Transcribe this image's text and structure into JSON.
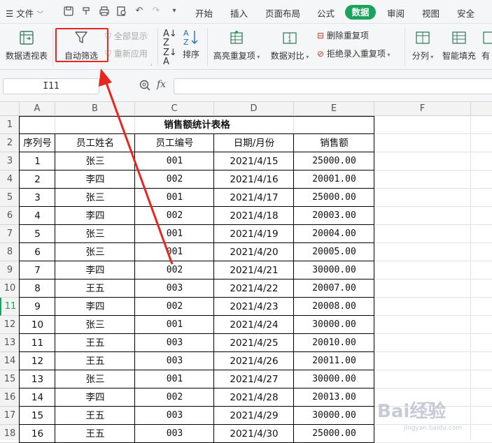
{
  "menubar": {
    "file_label": "文件",
    "tabs": [
      "开始",
      "插入",
      "页面布局",
      "公式",
      "数据",
      "审阅",
      "视图",
      "安全"
    ],
    "active_tab": "数据"
  },
  "ribbon": {
    "pivot": "数据透视表",
    "autofilter": "自动筛选",
    "show_all": "全部显示",
    "reapply": "重新应用",
    "sort": "排序",
    "highlight_dup": "高亮重复项",
    "compare": "数据对比",
    "remove_dup": "删除重复项",
    "reject_dup": "拒绝录入重复项",
    "split": "分列",
    "smart_fill": "智能填充",
    "cut_off": "有"
  },
  "formula_bar": {
    "cell_ref": "I11",
    "fx": "fx",
    "value": ""
  },
  "columns": [
    "A",
    "B",
    "C",
    "D",
    "E",
    "F"
  ],
  "rows": [
    "1",
    "2",
    "3",
    "4",
    "5",
    "6",
    "7",
    "8",
    "9",
    "10",
    "11",
    "12",
    "13",
    "14",
    "15",
    "16",
    "17",
    "18"
  ],
  "active_row": "11",
  "table": {
    "title": "销售额统计表格",
    "headers": [
      "序列号",
      "员工姓名",
      "员工编号",
      "日期/月份",
      "销售额"
    ],
    "data": [
      [
        "1",
        "张三",
        "001",
        "2021/4/15",
        "25000.00"
      ],
      [
        "2",
        "李四",
        "002",
        "2021/4/16",
        "20001.00"
      ],
      [
        "3",
        "张三",
        "001",
        "2021/4/17",
        "25000.00"
      ],
      [
        "4",
        "李四",
        "002",
        "2021/4/18",
        "20003.00"
      ],
      [
        "5",
        "张三",
        "001",
        "2021/4/19",
        "20004.00"
      ],
      [
        "6",
        "张三",
        "001",
        "2021/4/20",
        "20005.00"
      ],
      [
        "7",
        "李四",
        "002",
        "2021/4/21",
        "30000.00"
      ],
      [
        "8",
        "王五",
        "003",
        "2021/4/22",
        "20007.00"
      ],
      [
        "9",
        "李四",
        "002",
        "2021/4/23",
        "20008.00"
      ],
      [
        "10",
        "张三",
        "001",
        "2021/4/24",
        "30000.00"
      ],
      [
        "11",
        "王五",
        "003",
        "2021/4/25",
        "20010.00"
      ],
      [
        "12",
        "王五",
        "003",
        "2021/4/26",
        "20011.00"
      ],
      [
        "13",
        "张三",
        "001",
        "2021/4/27",
        "30000.00"
      ],
      [
        "14",
        "李四",
        "002",
        "2021/4/28",
        "20013.00"
      ],
      [
        "15",
        "王五",
        "003",
        "2021/4/29",
        "30000.00"
      ],
      [
        "16",
        "王五",
        "003",
        "2021/4/30",
        "25000.00"
      ]
    ]
  },
  "watermark": "Bai经验",
  "colors": {
    "accent": "#1aa35f",
    "annotation": "#e8251f"
  }
}
